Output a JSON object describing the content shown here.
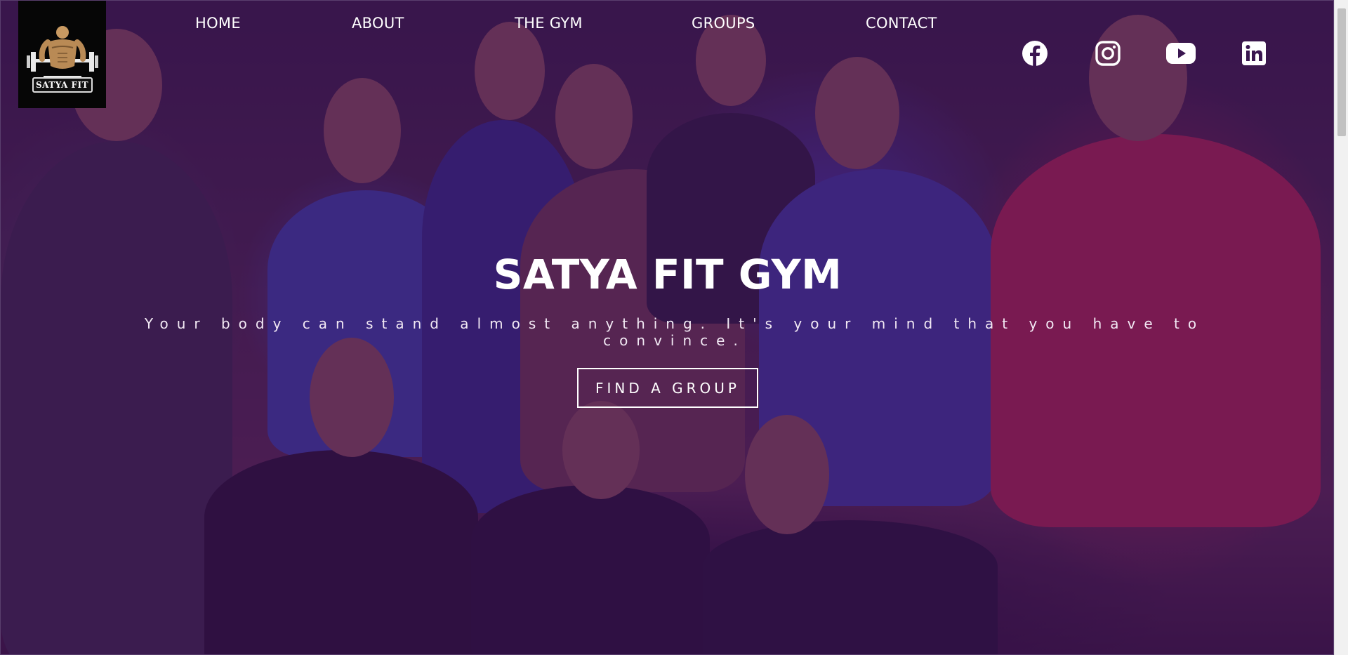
{
  "brand": {
    "logo_text": "SATYA FIT",
    "logo_icon": "bodybuilder-emblem-icon"
  },
  "nav": {
    "items": [
      {
        "label": "HOME"
      },
      {
        "label": "ABOUT"
      },
      {
        "label": "THE GYM"
      },
      {
        "label": "GROUPS"
      },
      {
        "label": "CONTACT"
      }
    ]
  },
  "social": [
    {
      "name": "facebook-icon"
    },
    {
      "name": "instagram-icon"
    },
    {
      "name": "youtube-icon"
    },
    {
      "name": "linkedin-icon"
    }
  ],
  "hero": {
    "title": "SATYA FIT GYM",
    "subtitle": "Your body can stand almost anything. It's your mind that you have to convince.",
    "cta_label": "FIND A GROUP"
  },
  "colors": {
    "overlay": "#460e60",
    "text": "#ffffff",
    "logo_bg": "#060606"
  }
}
